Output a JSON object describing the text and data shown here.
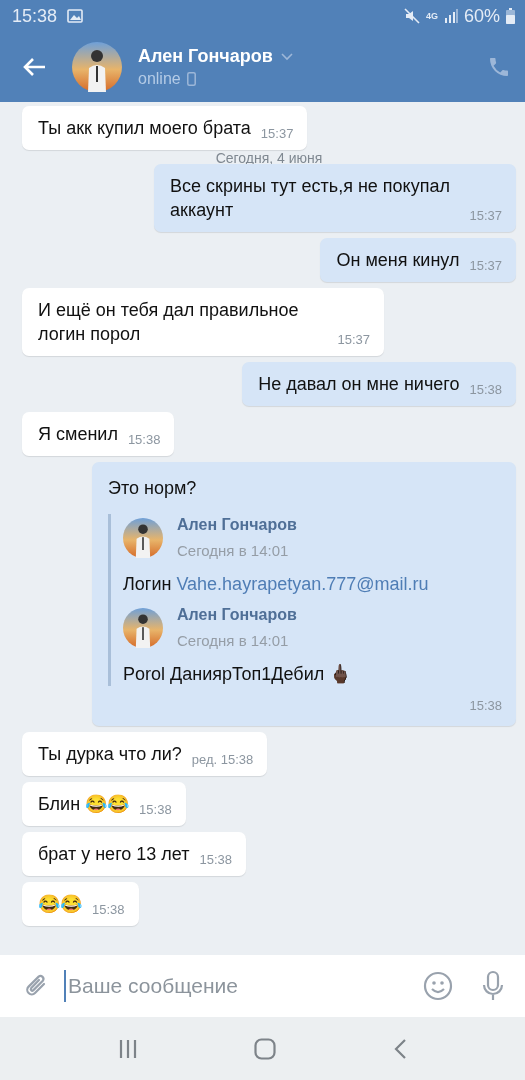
{
  "status_bar": {
    "time": "15:38",
    "network": "4G",
    "battery": "60%"
  },
  "header": {
    "name": "Ален Гончаров",
    "status": "online"
  },
  "date_label": "Сегодня, 4 июня",
  "messages": [
    {
      "kind": "text",
      "outgoing": false,
      "text": "Ты акк купил моего брата",
      "time": "15:37"
    },
    {
      "kind": "text",
      "outgoing": true,
      "text": "Все скрины тут есть,я не покупал аккаунт",
      "time": "15:37"
    },
    {
      "kind": "text",
      "outgoing": true,
      "text": "Он меня кинул",
      "time": "15:37"
    },
    {
      "kind": "text",
      "outgoing": false,
      "text": "И ещё он тебя дал правильное логин порол",
      "time": "15:37"
    },
    {
      "kind": "text",
      "outgoing": true,
      "text": "Не давал он мне ничего",
      "time": "15:38"
    },
    {
      "kind": "text",
      "outgoing": false,
      "text": "Я сменил",
      "time": "15:38"
    },
    {
      "kind": "forwarded",
      "outgoing": true,
      "text": "Это норм?",
      "time": "15:38",
      "forwards": [
        {
          "author": "Ален Гончаров",
          "time": "Сегодня в 14:01",
          "text": "Логин",
          "link": "Vahe.hayrapetyan.777@mail.ru"
        },
        {
          "author": "Ален Гончаров",
          "time": "Сегодня в 14:01",
          "text": "Porol ДаниярТоп1Дебил 🖕🏿"
        }
      ]
    },
    {
      "kind": "text",
      "outgoing": false,
      "text": "Ты дурка что ли?",
      "time": "ред. 15:38"
    },
    {
      "kind": "text",
      "outgoing": false,
      "text": "Блин 😂😂",
      "time": "15:38"
    },
    {
      "kind": "text",
      "outgoing": false,
      "text": "брат у него 13 лет",
      "time": "15:38"
    },
    {
      "kind": "text",
      "outgoing": false,
      "text": "😂😂",
      "time": "15:38"
    }
  ],
  "composer": {
    "placeholder": "Ваше сообщение"
  }
}
